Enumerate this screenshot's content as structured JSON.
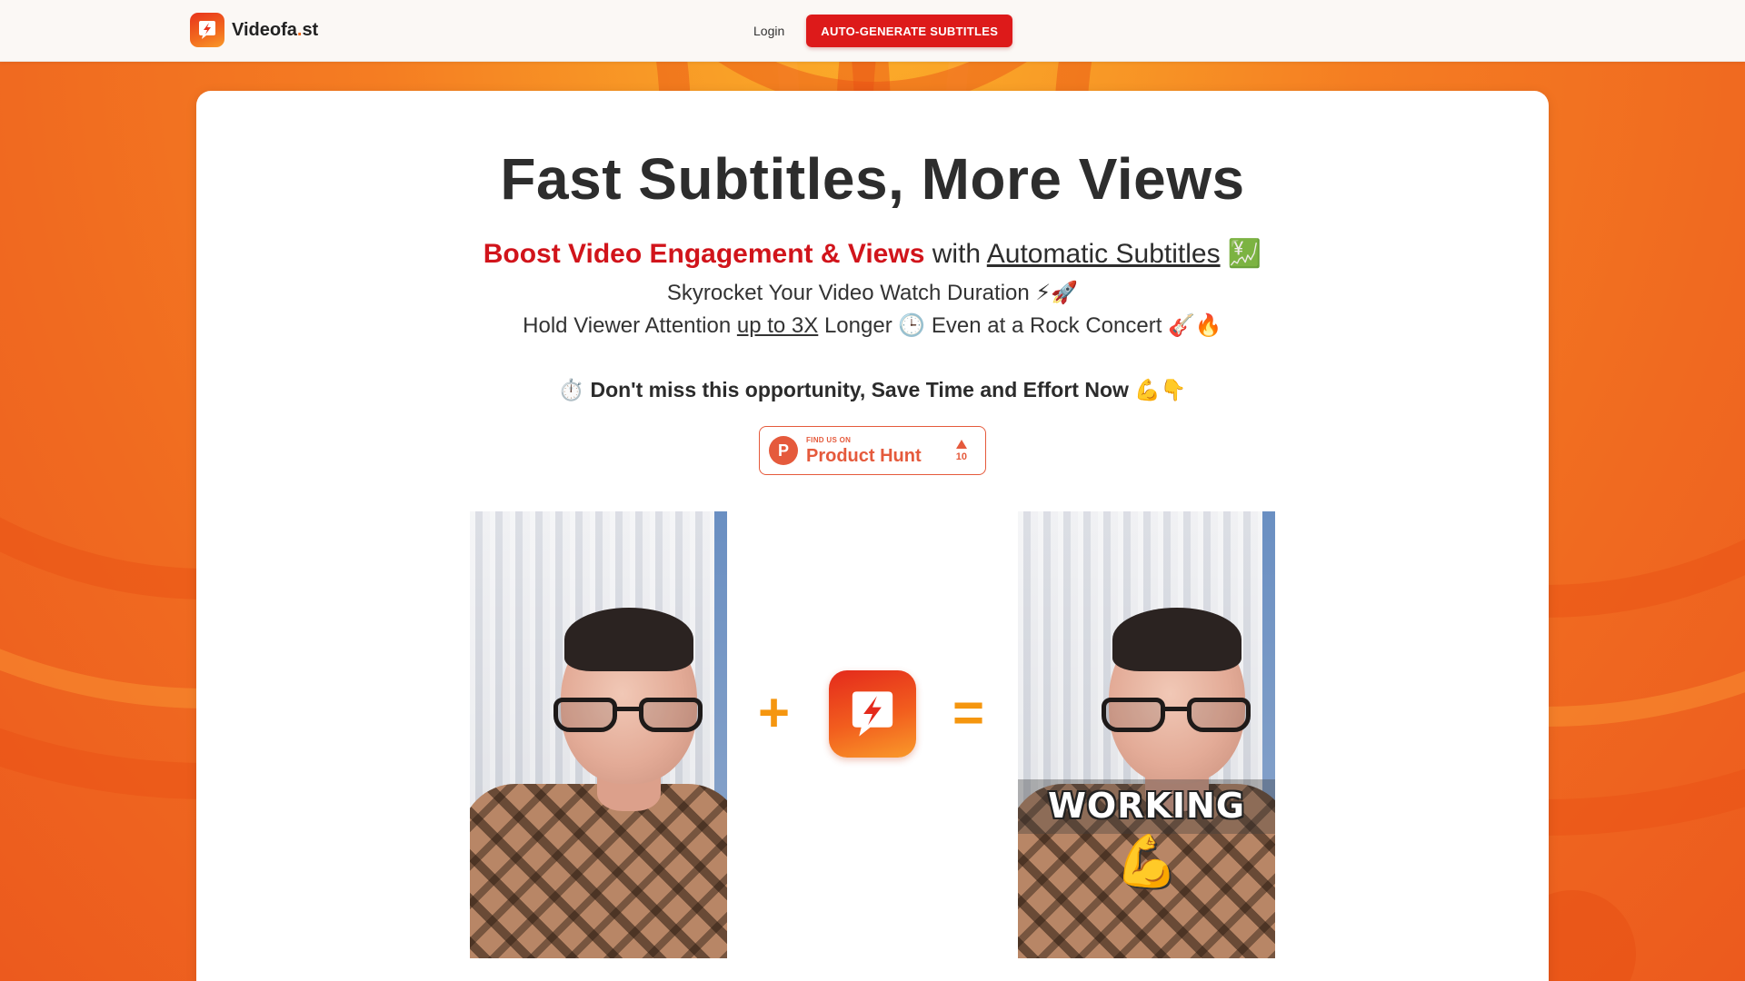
{
  "colors": {
    "brand_red": "#dd1a1a",
    "accent_orange": "#f26a1e",
    "headline_red": "#d1141b",
    "producthunt": "#e55a3c"
  },
  "header": {
    "logo_name": "Videofa",
    "logo_dot": ".",
    "logo_tld": "st",
    "login_label": "Login",
    "cta_label": "AUTO-GENERATE SUBTITLES"
  },
  "hero": {
    "title": "Fast Subtitles, More Views",
    "subhead_red": "Boost Video Engagement & Views",
    "subhead_mid": "with",
    "subhead_link": "Automatic Subtitles",
    "subhead_emoji": "💹",
    "line2_text": "Skyrocket Your Video Watch Duration",
    "line2_emoji": "⚡🚀",
    "line3_pre": "Hold Viewer Attention",
    "line3_link": "up to 3X",
    "line3_mid": "Longer",
    "line3_clock": "🕒",
    "line3_post": "Even at a Rock Concert",
    "line3_emoji": "🎸🔥",
    "cta_emoji_start": "⏱️",
    "cta_text": "Don't miss this opportunity, Save Time and Effort Now",
    "cta_emoji_end": "💪👇"
  },
  "producthunt": {
    "small": "FIND US ON",
    "big": "Product Hunt",
    "logo_letter": "P",
    "votes": "10"
  },
  "demo": {
    "plus": "+",
    "equals": "=",
    "caption_word": "WORKING",
    "caption_emoji": "💪"
  }
}
